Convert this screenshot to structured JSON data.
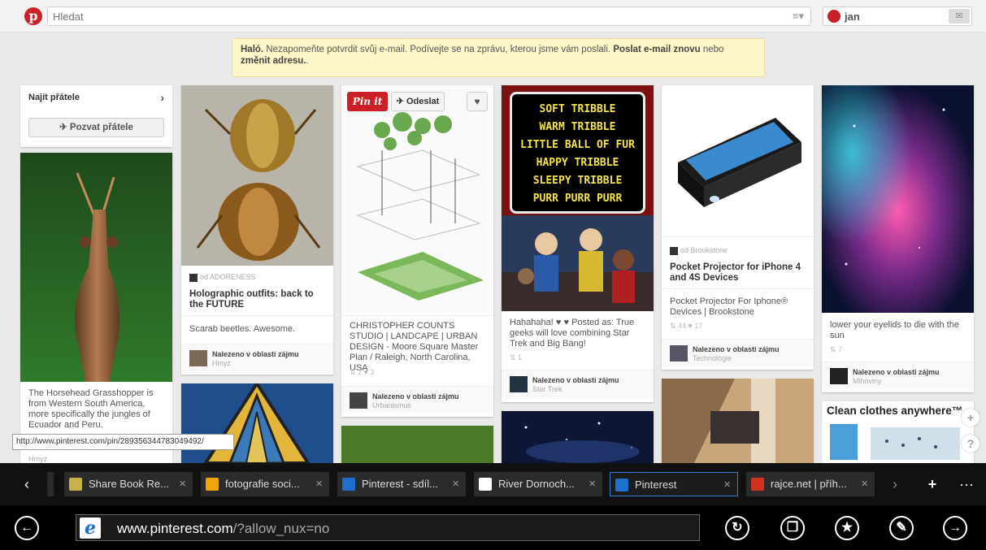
{
  "header": {
    "logo": "p",
    "search_placeholder": "Hledat",
    "menu_glyph": "≡▾",
    "user_name": "jan",
    "messages_glyph": "✉"
  },
  "notice": {
    "greeting": "Haló.",
    "text": "Nezapomeňte potvrdit svůj e-mail. Podívejte se na zprávu, kterou jsme vám poslali.",
    "resend_link": "Poslat e-mail znovu",
    "or": "nebo",
    "change_link": "změnit adresu.",
    "end": "."
  },
  "friends": {
    "title": "Najít přátele",
    "arrow": "›",
    "invite_label": "Pozvat přátele"
  },
  "pins": {
    "grasshopper": {
      "desc": "The Horsehead Grasshopper is from Western South America, more specifically the jungles of Ecuador and Peru.",
      "board": "Hmyz"
    },
    "beetles": {
      "source": "od ADORENESS",
      "title": "Holographic outfits: back to the FUTURE",
      "desc": "Scarab beetles. Awesome.",
      "found": "Nalezeno v oblasti zájmu",
      "board": "Hmyz"
    },
    "landscape": {
      "pinit": "Pin it",
      "send": "Odeslat",
      "like": "♥",
      "desc": "CHRISTOPHER COUNTS STUDIO | LANDCAPE | URBAN DESIGN - Moore Square Master Plan / Raleigh, North Carolina, USA",
      "stats": "⇅ 2  ♥ 3",
      "found": "Nalezeno v oblasti zájmu",
      "board": "Urbanismus"
    },
    "startrek": {
      "poem": [
        "SOFT TRIBBLE",
        "WARM TRIBBLE",
        "LITTLE BALL OF FUR",
        "HAPPY TRIBBLE",
        "SLEEPY TRIBBLE",
        "PURR PURR PURR"
      ],
      "desc": "Hahahaha! ♥ ♥ Posted as: True geeks will love combining Star Trek and Big Bang!",
      "stats": "⇅ 1",
      "found": "Nalezeno v oblasti zájmu",
      "board": "Star Trek"
    },
    "projector": {
      "source": "od Brookstone",
      "title": "Pocket Projector for iPhone 4 and 4S Devices",
      "desc": "Pocket Projector For Iphone® Devices | Brookstone",
      "stats": "⇅ 44  ♥ 17",
      "found": "Nalezeno v oblasti zájmu",
      "board": "Technologie"
    },
    "nebula": {
      "desc": "lower your eyelids to die with the sun",
      "stats": "⇅ 7",
      "found": "Nalezeno v oblasti zájmu",
      "board": "Mlhoviny"
    },
    "clothes": {
      "headline": "Clean clothes anywhere™"
    }
  },
  "tooltip": "http://www.pinterest.com/pin/289356344783049492/",
  "float_buttons": {
    "plus": "+",
    "help": "?"
  },
  "tabs": {
    "prev": "‹",
    "next": "›",
    "new": "+",
    "more": "···",
    "items": [
      {
        "label": "Share Book Re...",
        "color": "#c9b24a"
      },
      {
        "label": "fotografie soci...",
        "color": "#f0a500"
      },
      {
        "label": "Pinterest - sdíl...",
        "color": "#1e6fd0"
      },
      {
        "label": "River Dornoch...",
        "color": "#ffffff"
      },
      {
        "label": "Pinterest",
        "color": "#1e6fd0"
      },
      {
        "label": "rajce.net | příh...",
        "color": "#d03020"
      }
    ],
    "close_glyph": "×"
  },
  "address": {
    "back": "←",
    "url_domain": "www.pinterest.com",
    "url_path": "/?allow_nux=no",
    "refresh": "↻",
    "tabs_btn": "❐",
    "favorites": "★",
    "tools": "✎",
    "forward": "→"
  }
}
